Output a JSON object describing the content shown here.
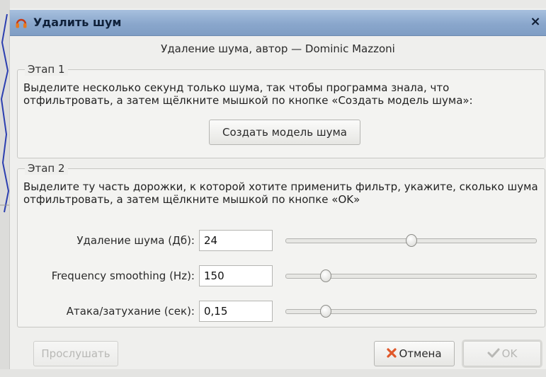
{
  "dialog": {
    "title": "Удалить шум",
    "close_label": "×",
    "header": "Удаление шума, автор — Dominic Mazzoni"
  },
  "stage1": {
    "legend": "Этап 1",
    "description": "Выделите несколько секунд только шума, так чтобы программа знала, что отфильтровать, а затем щёлкните мышкой по кнопке «Создать модель шума»:",
    "profile_button": "Создать модель шума"
  },
  "stage2": {
    "legend": "Этап 2",
    "description": "Выделите ту часть дорожки, к которой хотите применить фильтр, укажите, сколько шума отфильтровать, а затем щёлкните мышкой по кнопке «OK»",
    "rows": [
      {
        "label": "Удаление шума (Дб):",
        "value": "24",
        "slider_fraction": 0.5
      },
      {
        "label": "Frequency smoothing (Hz):",
        "value": "150",
        "slider_fraction": 0.16
      },
      {
        "label": "Атака/затухание (сек):",
        "value": "0,15",
        "slider_fraction": 0.16
      }
    ]
  },
  "footer": {
    "preview_label": "Прослушать",
    "cancel_label": "Отмена",
    "ok_label": "OK"
  },
  "icons": {
    "title": "headphones-icon",
    "cancel": "x-mark-icon",
    "ok": "checkmark-icon"
  },
  "colors": {
    "titlebar": "#8aa7cc",
    "cancel_icon": "#e0582a",
    "ok_icon": "#b8b8b5"
  }
}
